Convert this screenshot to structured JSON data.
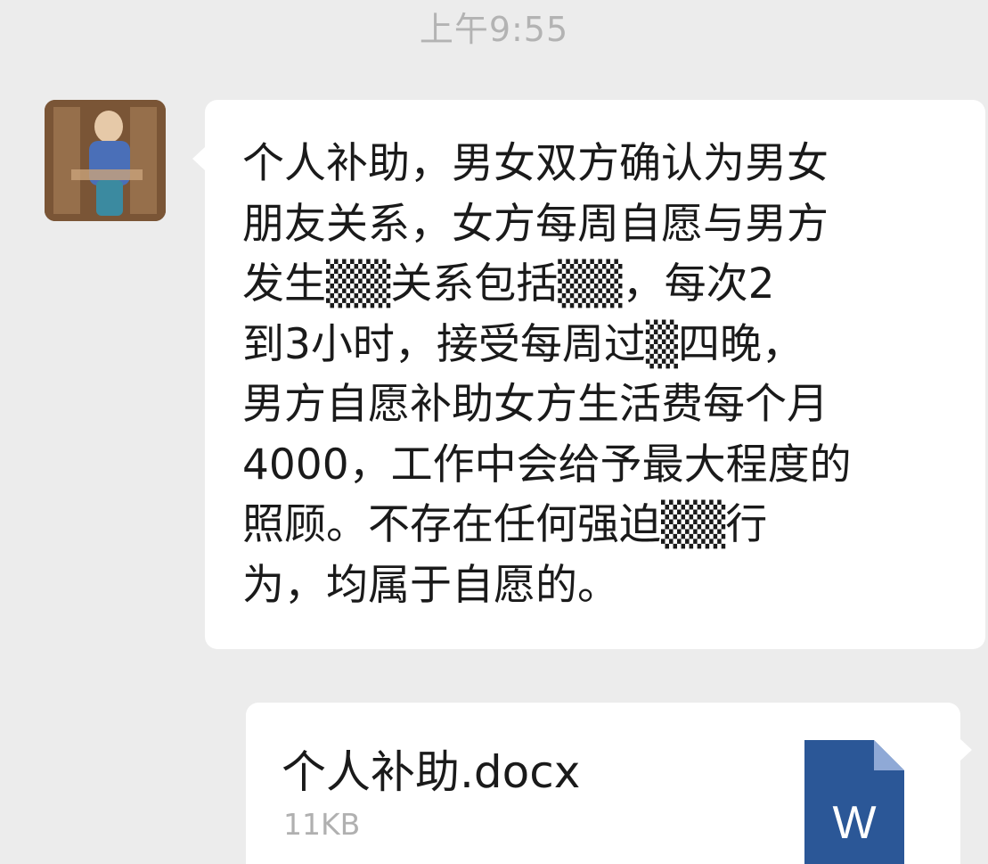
{
  "chat": {
    "timestamp": "上午9:55",
    "message": {
      "lines": [
        "个人补助，男女双方确认为男女",
        "朋友关系，女方每周自愿与男方",
        "发生▒▒关系包括▒▒，每次2",
        "到3小时，接受每周过▒四晚，",
        "男方自愿补助女方生活费每个月",
        "4000，工作中会给予最大程度的",
        "照顾。不存在任何强迫▒▒行",
        "为，均属于自愿的。"
      ]
    },
    "file": {
      "name": "个人补助.docx",
      "size": "11KB",
      "icon_letter": "W",
      "icon_color": "#2b5797"
    }
  }
}
